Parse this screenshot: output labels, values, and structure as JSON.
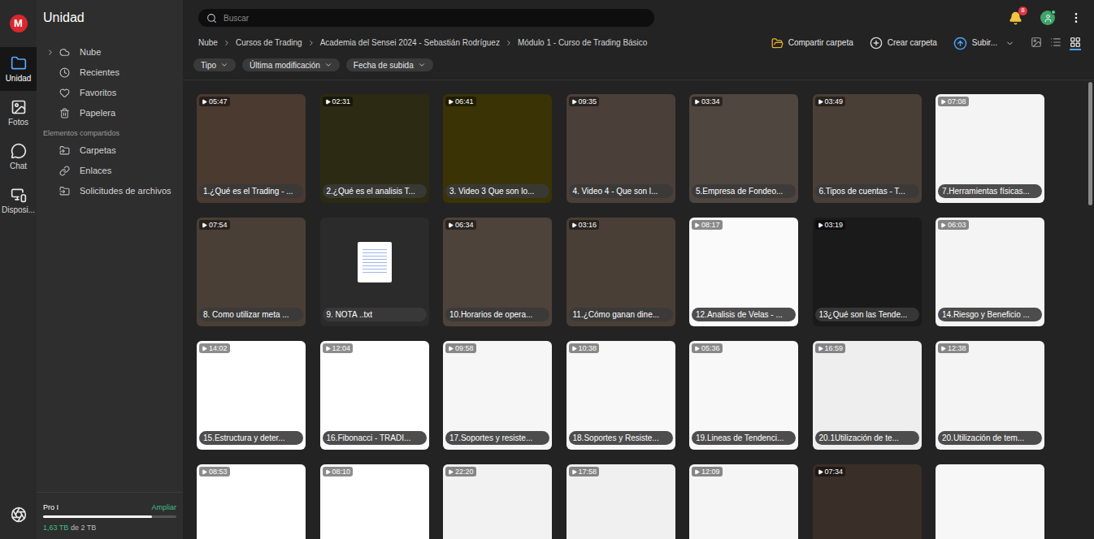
{
  "logo": "M",
  "rail": [
    {
      "label": "Unidad",
      "selected": true
    },
    {
      "label": "Fotos",
      "selected": false
    },
    {
      "label": "Chat",
      "selected": false
    },
    {
      "label": "Disposi...",
      "selected": false
    }
  ],
  "sidebar": {
    "title": "Unidad",
    "items": [
      {
        "label": "Nube",
        "expanded": false
      },
      {
        "label": "Recientes"
      },
      {
        "label": "Favoritos"
      },
      {
        "label": "Papelera"
      }
    ],
    "shared_heading": "Elementos compartidos",
    "shared_items": [
      {
        "label": "Carpetas"
      },
      {
        "label": "Enlaces"
      },
      {
        "label": "Solicitudes de archivos"
      }
    ],
    "plan": {
      "name": "Pro I",
      "upgrade": "Ampliar",
      "level": 0.815,
      "used": "1,63 TB",
      "rest": "de 2 TB"
    }
  },
  "search": {
    "placeholder": "Buscar"
  },
  "notifications": {
    "count": "8"
  },
  "breadcrumb": [
    "Nube",
    "Cursos de Trading",
    "Academia del Sensei 2024 - Sebastián Rodríguez",
    "Módulo 1 - Curso de Trading Básico"
  ],
  "actions": [
    {
      "label": "Compartir carpeta",
      "kind": "share"
    },
    {
      "label": "Crear carpeta",
      "kind": "create"
    },
    {
      "label": "Subir...",
      "kind": "upload"
    }
  ],
  "views": [
    {
      "kind": "thumbnail",
      "selected": false
    },
    {
      "kind": "list",
      "selected": false
    },
    {
      "kind": "grid",
      "selected": true
    }
  ],
  "filters": [
    {
      "label": "Tipo"
    },
    {
      "label": "Última modificación"
    },
    {
      "label": "Fecha de subida"
    }
  ],
  "scrollbar": {
    "level": 0.27
  },
  "files": [
    {
      "name": "1.¿Qué es el Trading - ...",
      "duration": "05:47",
      "kind": "video",
      "color": "#4a3a30"
    },
    {
      "name": "2.¿Qué es el analisis T...",
      "duration": "02:31",
      "kind": "video",
      "color": "#2c2a12"
    },
    {
      "name": "3. Video 3 Que son lo...",
      "duration": "06:41",
      "kind": "video",
      "color": "#3a3306"
    },
    {
      "name": "4. Video 4 - Que son l...",
      "duration": "09:35",
      "kind": "video",
      "color": "#4b4039"
    },
    {
      "name": "5.Empresa de Fondeo...",
      "duration": "03:34",
      "kind": "video",
      "color": "#4f4640"
    },
    {
      "name": "6.Tipos de cuentas - T...",
      "duration": "03:49",
      "kind": "video",
      "color": "#4a3f36"
    },
    {
      "name": "7.Herramientas físicas...",
      "duration": "07:08",
      "kind": "video",
      "color": "#f4f4f4"
    },
    {
      "name": "8. Como utilizar meta ...",
      "duration": "07:54",
      "kind": "video",
      "color": "#4a3f36"
    },
    {
      "name": "9. NOTA ..txt",
      "kind": "document",
      "color": "#2b2b2b"
    },
    {
      "name": "10.Horarios de opera...",
      "duration": "06:34",
      "kind": "video",
      "color": "#4d433b"
    },
    {
      "name": "11.¿Cómo ganan dine...",
      "duration": "03:16",
      "kind": "video",
      "color": "#4a3f36"
    },
    {
      "name": "12.Analisis de Velas - ...",
      "duration": "08:17",
      "kind": "video",
      "color": "#fafafa"
    },
    {
      "name": "13¿Qué son las Tende...",
      "duration": "03:19",
      "kind": "video",
      "color": "#1a1a1a"
    },
    {
      "name": "14.Riesgo y Beneficio ...",
      "duration": "06:03",
      "kind": "video",
      "color": "#f4f4f4"
    },
    {
      "name": "15.Estructura y deter...",
      "duration": "14:02",
      "kind": "video",
      "color": "#ffffff"
    },
    {
      "name": "16.Fibonacci - TRADI...",
      "duration": "12:04",
      "kind": "video",
      "color": "#ffffff"
    },
    {
      "name": "17.Soportes y resiste...",
      "duration": "09:58",
      "kind": "video",
      "color": "#f6f6f6"
    },
    {
      "name": "18.Soportes y Resiste...",
      "duration": "10:38",
      "kind": "video",
      "color": "#f8f8f8"
    },
    {
      "name": "19.Lineas de Tendenci...",
      "duration": "05:36",
      "kind": "video",
      "color": "#f8f8f8"
    },
    {
      "name": "20.1Utilización de te...",
      "duration": "16:59",
      "kind": "video",
      "color": "#eeeeee"
    },
    {
      "name": "20.Utilización de tem...",
      "duration": "12:38",
      "kind": "video",
      "color": "#f4f4f4"
    },
    {
      "duration": "08:53",
      "kind": "video",
      "color": "#ffffff"
    },
    {
      "duration": "08:10",
      "kind": "video",
      "color": "#ffffff"
    },
    {
      "duration": "22:20",
      "kind": "video",
      "color": "#f2f2f2"
    },
    {
      "duration": "17:58",
      "kind": "video",
      "color": "#f0f0f0"
    },
    {
      "duration": "12:09",
      "kind": "video",
      "color": "#f5f5f5"
    },
    {
      "duration": "07:34",
      "kind": "video",
      "color": "#3a2e28"
    },
    {
      "kind": "image",
      "color": "#f7f7f7"
    }
  ]
}
